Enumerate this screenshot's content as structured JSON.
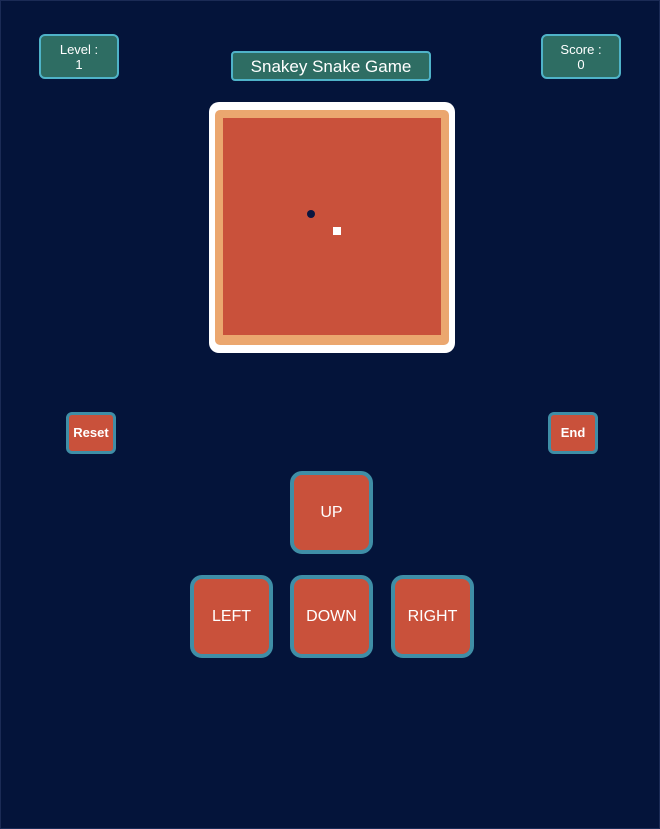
{
  "header": {
    "title": "Snakey Snake Game",
    "level": {
      "label": "Level :",
      "value": "1"
    },
    "score": {
      "label": "Score :",
      "value": "0"
    }
  },
  "board": {
    "colors": {
      "frame": "#ffffff",
      "border": "#eba76f",
      "field": "#c9513b",
      "food": "#0a1640",
      "snake": "#ffffff"
    }
  },
  "controls": {
    "reset_label": "Reset",
    "end_label": "End",
    "up_label": "UP",
    "left_label": "LEFT",
    "down_label": "DOWN",
    "right_label": "RIGHT"
  },
  "theme": {
    "background": "#04143a",
    "accent": "#2e6d63",
    "button_border": "#3f8ea6"
  }
}
